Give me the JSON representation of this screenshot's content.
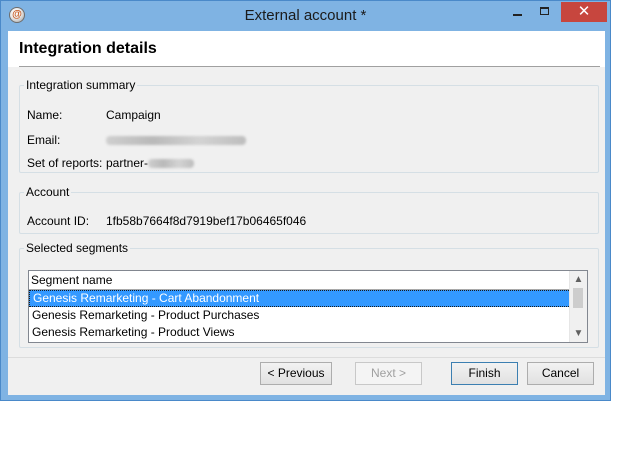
{
  "window": {
    "title": "External account *",
    "close_glyph": "✕",
    "icons": [
      "app-icon",
      "minimize-icon",
      "maximize-icon",
      "close-icon"
    ]
  },
  "header": {
    "title": "Integration details"
  },
  "summary": {
    "legend": "Integration summary",
    "name_label": "Name:",
    "name_value": "Campaign",
    "email_label": "Email:",
    "reports_label": "Set of reports:",
    "reports_value": "partner-"
  },
  "account": {
    "legend": "Account",
    "id_label": "Account ID:",
    "id_value": "1fb58b7664f8d7919bef17b06465f046"
  },
  "segments": {
    "legend": "Selected segments",
    "column_header": "Segment name",
    "rows": [
      "Genesis Remarketing - Cart Abandonment",
      "Genesis Remarketing - Product Purchases",
      "Genesis Remarketing - Product Views"
    ],
    "selected_index": 0,
    "scroll_up_glyph": "▲",
    "scroll_down_glyph": "▼"
  },
  "buttons": {
    "previous": "< Previous",
    "next": "Next >",
    "finish": "Finish",
    "cancel": "Cancel"
  },
  "colors": {
    "window_frame": "#7fb3e3",
    "close_button": "#c7463e",
    "selection": "#3399ff"
  }
}
